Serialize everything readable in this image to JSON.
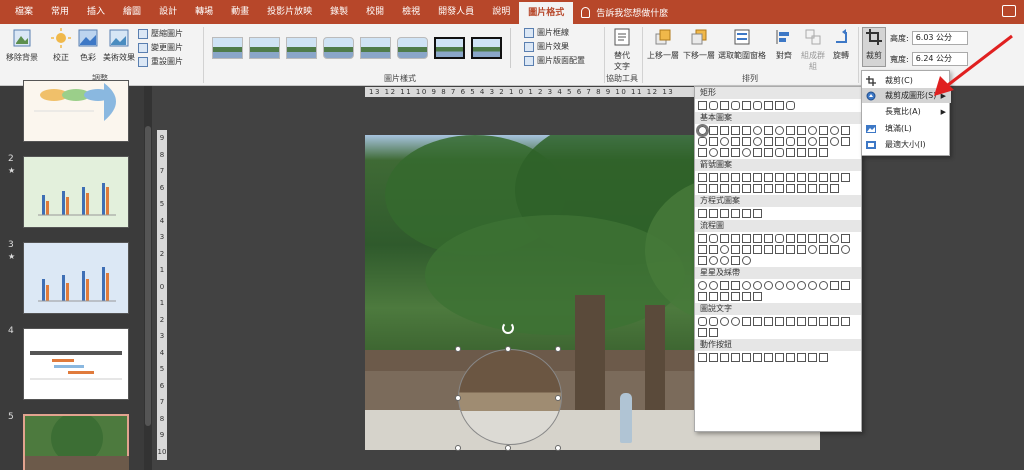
{
  "tabs": [
    "檔案",
    "常用",
    "插入",
    "繪圖",
    "設計",
    "轉場",
    "動畫",
    "投影片放映",
    "錄製",
    "校閱",
    "檢視",
    "開發人員",
    "說明",
    "圖片格式"
  ],
  "active_tab": "圖片格式",
  "tellme": "告訴我您想做什麼",
  "ribbon": {
    "remove_bg": "移除背景",
    "corrections": "校正",
    "color": "色彩",
    "artistic": "美術效果",
    "compress": "壓縮圖片",
    "change": "變更圖片",
    "reset": "重設圖片",
    "adjust_label": "調整",
    "styles_label": "圖片樣式",
    "border": "圖片框線",
    "effects": "圖片效果",
    "layout": "圖片版面配置",
    "alt_text_line1": "替代",
    "alt_text_line2": "文字",
    "accessibility_label": "協助工具",
    "bring_forward": "上移一層",
    "send_backward": "下移一層",
    "selection_pane": "選取範圍窗格",
    "align": "對齊",
    "group": "組成群組",
    "rotate": "旋轉",
    "arrange_label": "排列",
    "crop": "裁剪",
    "height_label": "高度:",
    "height_value": "6.03 公分",
    "width_label": "寬度:",
    "width_value": "6.24 公分"
  },
  "slides": [
    {
      "num": "2",
      "star": "★"
    },
    {
      "num": "3",
      "star": "★"
    },
    {
      "num": "4",
      "star": ""
    },
    {
      "num": "5",
      "star": ""
    }
  ],
  "hruler": "13 12 11 10 9 8 7 6 5 4 3 2 1 0 1 2 3 4 5 6 7 8 9 10 11 12 13",
  "vruler": [
    "9",
    "8",
    "7",
    "6",
    "5",
    "4",
    "3",
    "2",
    "1",
    "0",
    "1",
    "2",
    "3",
    "4",
    "5",
    "6",
    "7",
    "8",
    "9",
    "10"
  ],
  "shapes": {
    "sections": [
      "矩形",
      "基本圖案",
      "箭號圖案",
      "方程式圖案",
      "流程圖",
      "星星及綵帶",
      "圖說文字",
      "動作按鈕"
    ]
  },
  "crop_menu": {
    "crop": "裁剪(C)",
    "crop_to_shape": "裁剪成圖形(S)",
    "aspect_ratio": "長寬比(A)",
    "fill": "填滿(L)",
    "fit": "最適大小(I)"
  },
  "colors": {
    "accent": "#b7472a",
    "arrow": "#e02020"
  }
}
